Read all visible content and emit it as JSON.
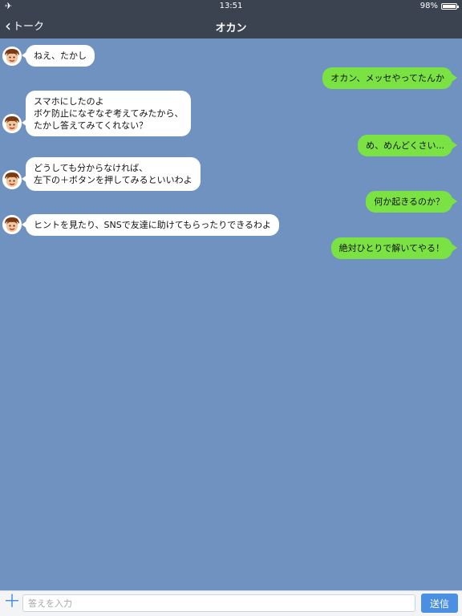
{
  "status_bar": {
    "time": "13:51",
    "battery_text": "98%",
    "battery_level": 0.98,
    "airplane_icon": "airplane-icon"
  },
  "nav": {
    "back_label": "トーク",
    "title": "オカン"
  },
  "messages": [
    {
      "side": "left",
      "lines": [
        "ねえ、たかし"
      ]
    },
    {
      "side": "right",
      "lines": [
        "オカン、メッセやってたんか"
      ]
    },
    {
      "side": "left",
      "lines": [
        "スマホにしたのよ",
        "ボケ防止になぞなぞ考えてみたから、",
        "たかし答えてみてくれない？"
      ]
    },
    {
      "side": "right",
      "lines": [
        "め、めんどくさい..."
      ]
    },
    {
      "side": "left",
      "lines": [
        "どうしても分からなければ、",
        "左下の＋ボタンを押してみるといいわよ"
      ]
    },
    {
      "side": "right",
      "lines": [
        "何か起きるのか？"
      ]
    },
    {
      "side": "left",
      "lines": [
        "ヒントを見たり、SNSで友達に助けてもらったりできるわよ"
      ]
    },
    {
      "side": "right",
      "lines": [
        "絶対ひとりで解いてやる！"
      ]
    }
  ],
  "input": {
    "placeholder": "答えを入力",
    "send_label": "送信",
    "plus_icon": "plus-icon"
  },
  "colors": {
    "background": "#7092c0",
    "header": "#3b4250",
    "bubble_left": "#ffffff",
    "bubble_right": "#7be243",
    "accent": "#4a8fe2"
  }
}
